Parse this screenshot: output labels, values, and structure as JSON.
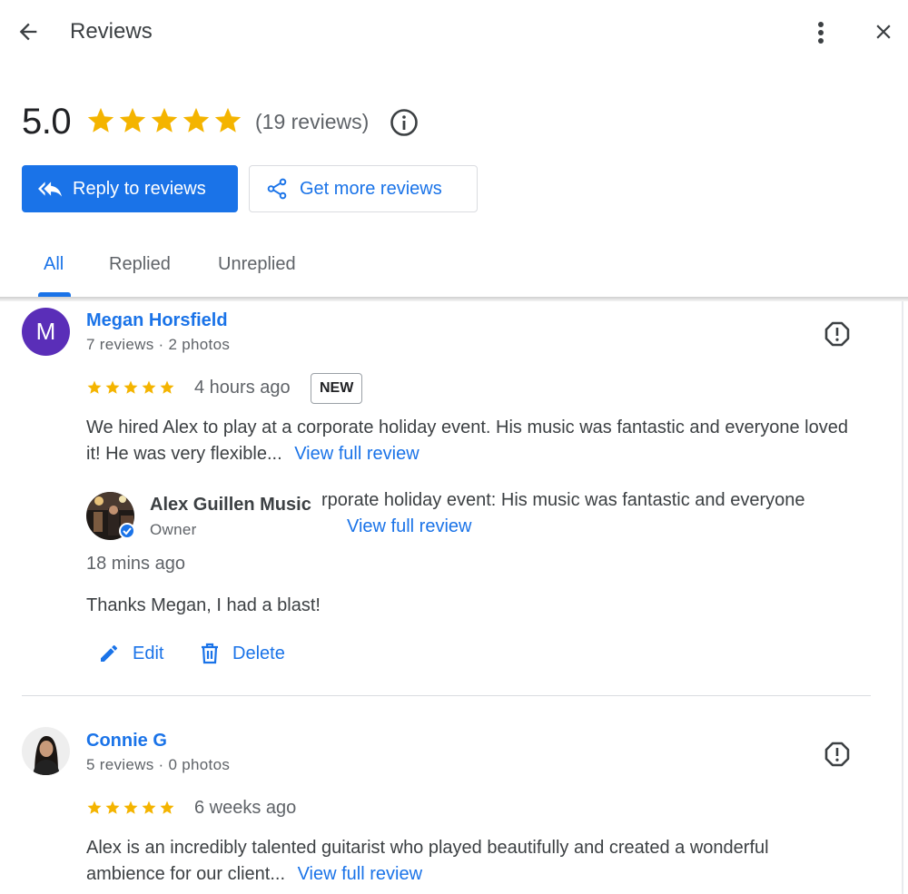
{
  "header": {
    "title": "Reviews",
    "back_icon": "arrow-left-icon",
    "more_icon": "more-vert-icon",
    "close_icon": "close-icon"
  },
  "summary": {
    "rating": "5.0",
    "star_count": 5,
    "count_text": "(19 reviews)",
    "info_icon": "info-icon"
  },
  "actions": {
    "reply_label": "Reply to reviews",
    "get_more_label": "Get more reviews"
  },
  "tabs": [
    {
      "label": "All",
      "active": true
    },
    {
      "label": "Replied",
      "active": false
    },
    {
      "label": "Unreplied",
      "active": false
    }
  ],
  "reviews": [
    {
      "avatar_letter": "M",
      "name": "Megan Horsfield",
      "meta": "7 reviews · 2 photos",
      "stars": 5,
      "time": "4 hours ago",
      "badge": "NEW",
      "text": "We hired Alex to play at a corporate holiday event. His music was fantastic and everyone loved it! He was very flexible...",
      "view_full": "View full review",
      "reply": {
        "owner_name": "Alex Guillen Music",
        "owner_role": "Owner",
        "overlay_text": "rporate holiday event: His music was fantastic and everyone",
        "overlay_view_full": "View full review",
        "time": "18 mins ago",
        "text": "Thanks Megan, I had a blast!",
        "edit_label": "Edit",
        "delete_label": "Delete"
      }
    },
    {
      "name": "Connie G",
      "meta": "5 reviews · 0 photos",
      "stars": 5,
      "time": "6 weeks ago",
      "text_line1": "Alex is an incredibly talented guitarist who played beautifully and created a wonderful",
      "text_line2": "ambience for our client...",
      "view_full": "View full review"
    }
  ],
  "colors": {
    "accent": "#1a73e8",
    "star": "#f4b400",
    "avatar_purple": "#5a2eb8",
    "text_secondary": "#5f6368"
  }
}
